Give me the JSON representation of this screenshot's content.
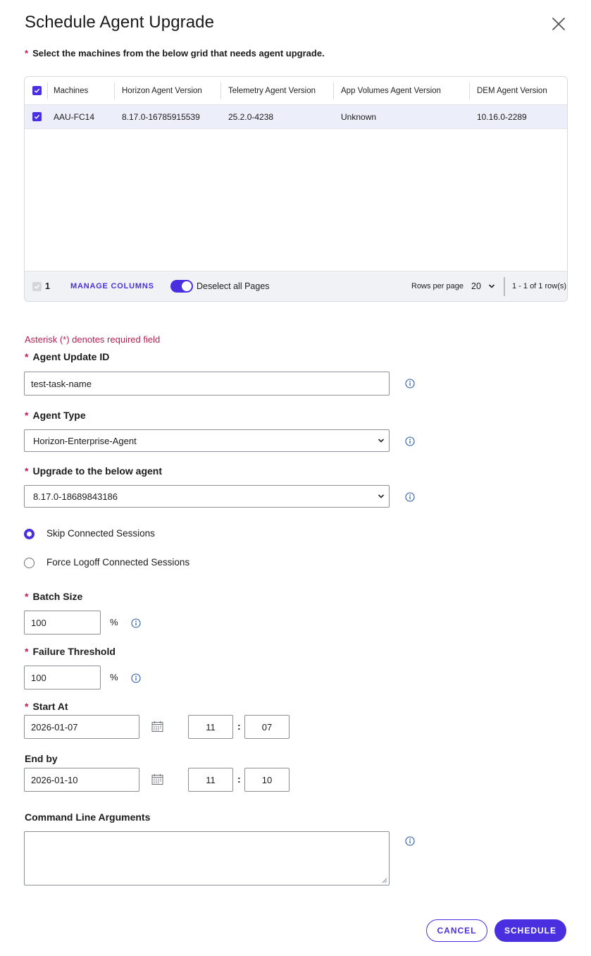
{
  "dialog": {
    "title": "Schedule Agent Upgrade"
  },
  "grid": {
    "instruction": "Select the machines from the below grid that needs agent upgrade.",
    "columns": [
      "Machines",
      "Horizon Agent Version",
      "Telemetry Agent Version",
      "App Volumes Agent Version",
      "DEM Agent Version"
    ],
    "rows": [
      {
        "selected": true,
        "cells": [
          "AAU-FC14",
          "8.17.0-16785915539",
          "25.2.0-4238",
          "Unknown",
          "10.16.0-2289"
        ]
      }
    ],
    "footer": {
      "selected_count": "1",
      "manage_columns": "MANAGE COLUMNS",
      "deselect_label": "Deselect all Pages",
      "rows_per_page_label": "Rows per page",
      "rows_per_page_value": "20",
      "range_text": "1 - 1 of 1 row(s)"
    }
  },
  "form": {
    "required_note": "Asterisk (*) denotes required field",
    "required_marker": "*",
    "agent_update_id": {
      "label": "Agent Update ID",
      "value": "test-task-name"
    },
    "agent_type": {
      "label": "Agent Type",
      "value": "Horizon-Enterprise-Agent"
    },
    "upgrade_to": {
      "label": "Upgrade to the below agent",
      "value": "8.17.0-18689843186"
    },
    "sessions": {
      "options": [
        "Skip Connected Sessions",
        "Force Logoff Connected Sessions"
      ],
      "selected": "Skip Connected Sessions"
    },
    "batch_size": {
      "label": "Batch Size",
      "value": "100",
      "unit": "%"
    },
    "failure_threshold": {
      "label": "Failure Threshold",
      "value": "100",
      "unit": "%"
    },
    "start_at": {
      "label": "Start At",
      "date": "2026-01-07",
      "hour": "11",
      "minute": "07"
    },
    "end_by": {
      "label": "End by",
      "date": "2026-01-10",
      "hour": "11",
      "minute": "10"
    },
    "command_line": {
      "label": "Command Line Arguments",
      "value": ""
    },
    "time_separator": ":"
  },
  "actions": {
    "cancel": "CANCEL",
    "schedule": "SCHEDULE"
  },
  "colors": {
    "accent": "#4a2fe0",
    "required": "#b3204f",
    "row_selected": "#eceffa"
  }
}
